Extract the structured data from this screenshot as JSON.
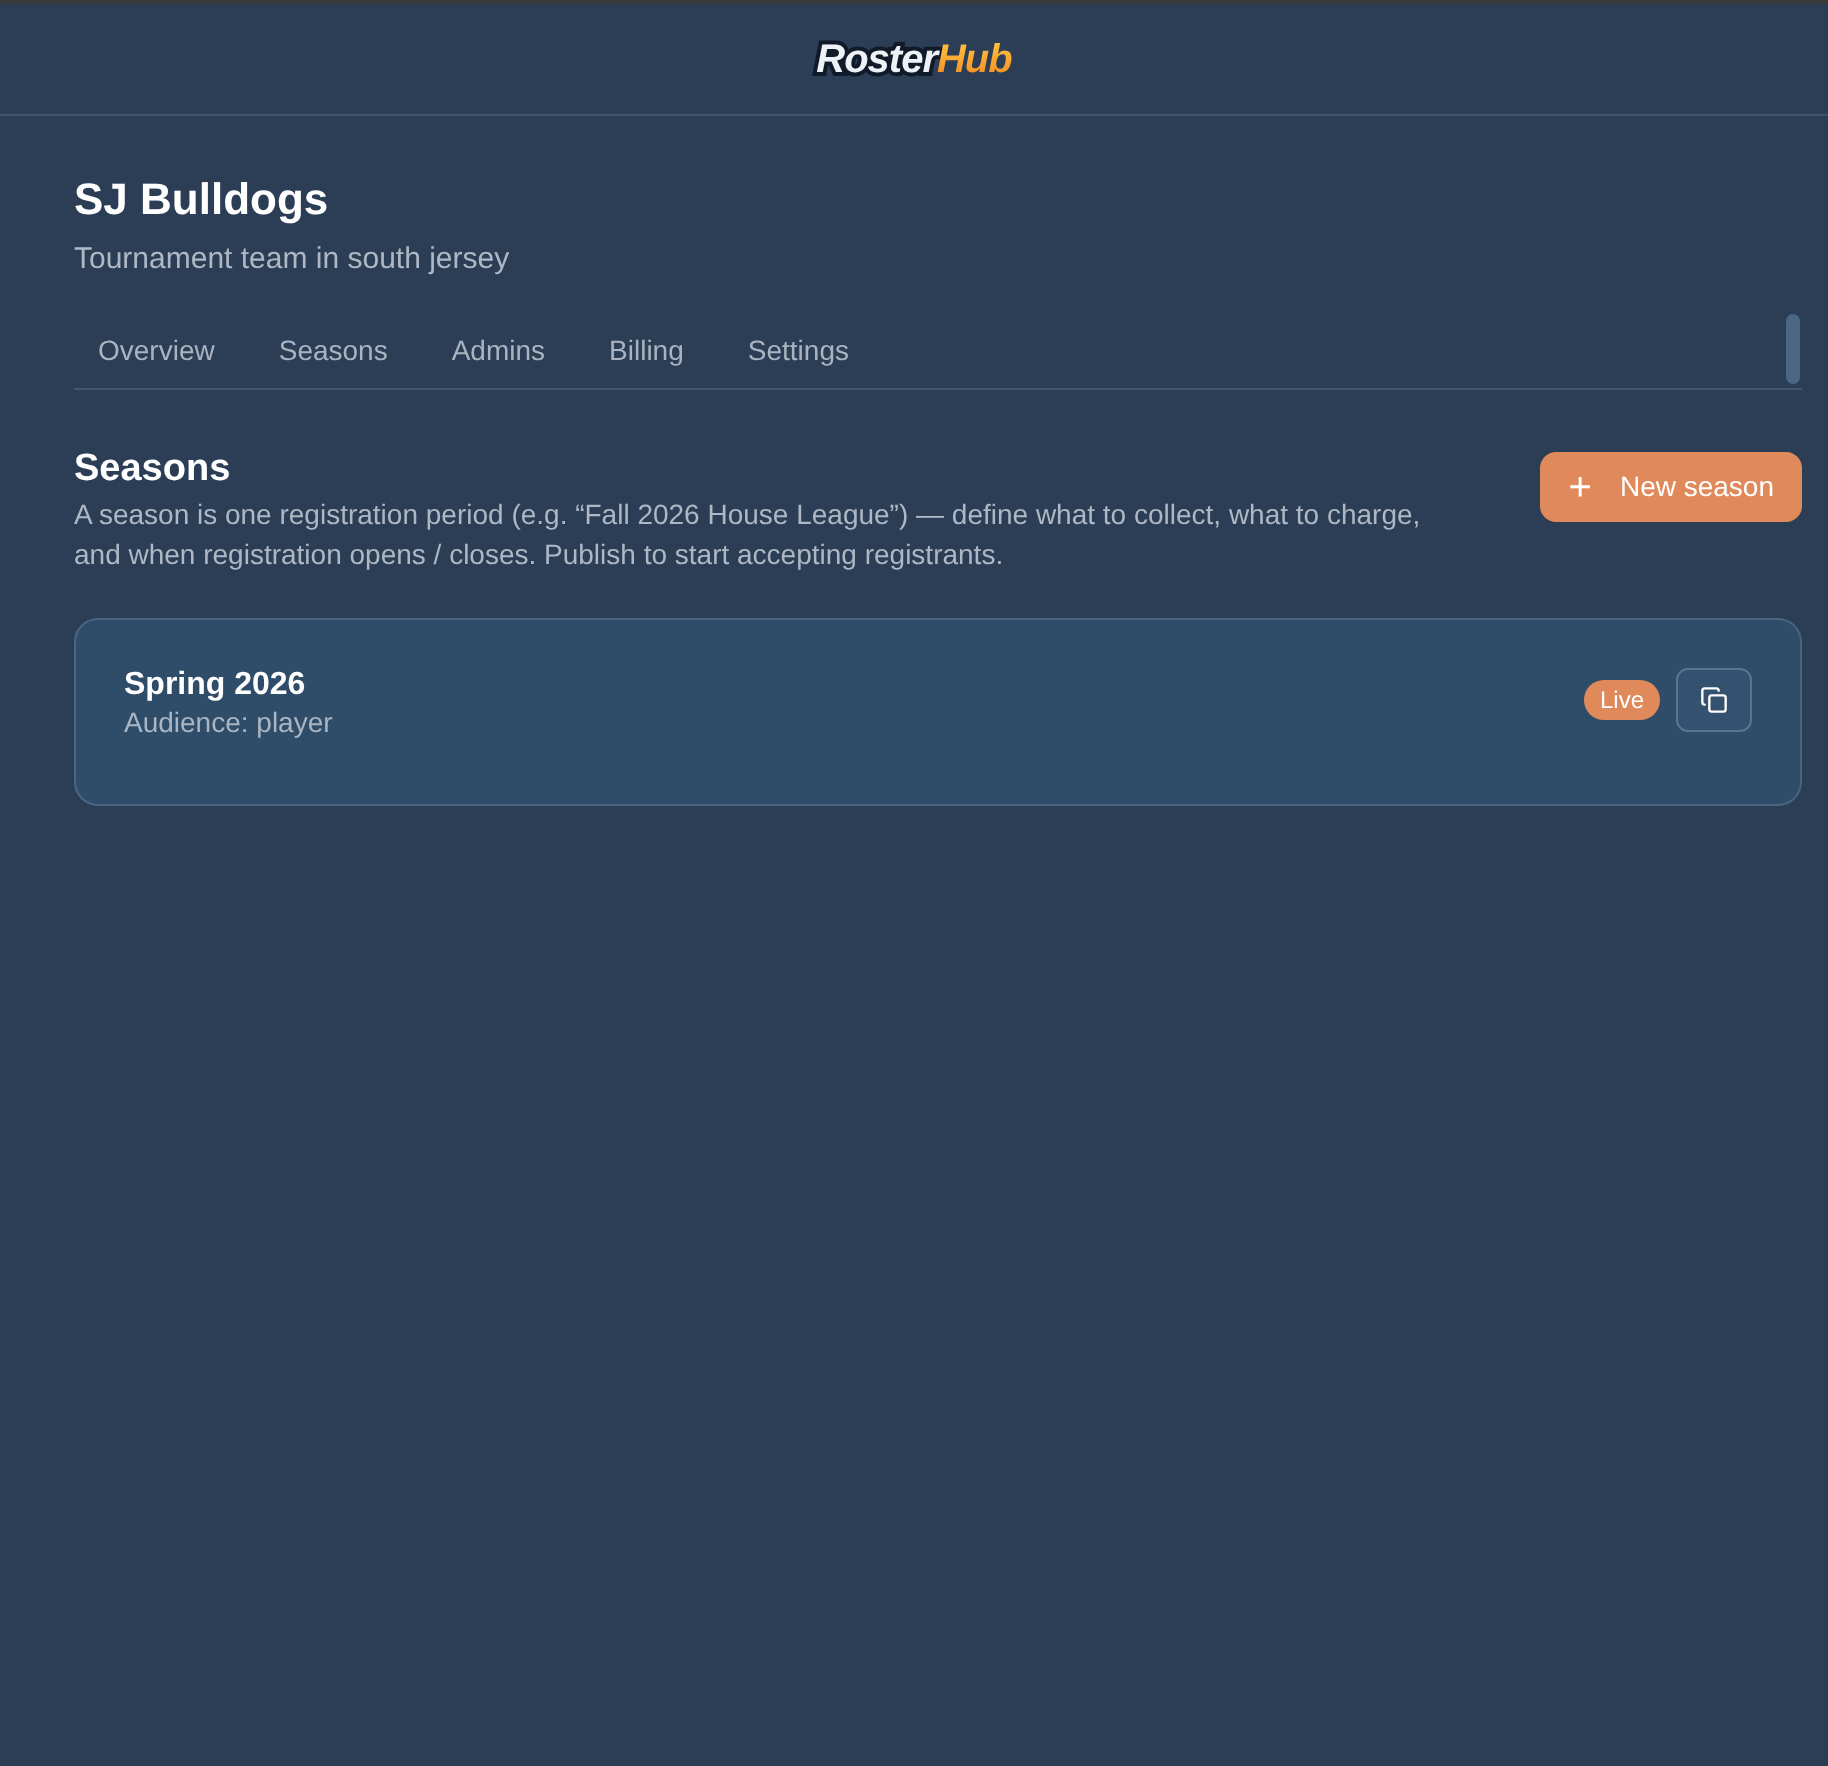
{
  "header": {
    "logo": {
      "primary": "Roster",
      "accent": "Hub"
    }
  },
  "team": {
    "name": "SJ Bulldogs",
    "description": "Tournament team in south jersey"
  },
  "tabs": [
    {
      "label": "Overview",
      "selected": false
    },
    {
      "label": "Seasons",
      "selected": false
    },
    {
      "label": "Admins",
      "selected": false
    },
    {
      "label": "Billing",
      "selected": false
    },
    {
      "label": "Settings",
      "selected": false
    }
  ],
  "section": {
    "title": "Seasons",
    "description": "A season is one registration period (e.g. “Fall 2026 House League”) — define what to collect, what to charge, and when registration opens / closes. Publish to start accepting registrants.",
    "new_button": {
      "icon": "+",
      "label": "New season"
    }
  },
  "seasons": [
    {
      "name": "Spring 2026",
      "audience": "Audience: player",
      "status": "Live",
      "live": true
    }
  ]
}
